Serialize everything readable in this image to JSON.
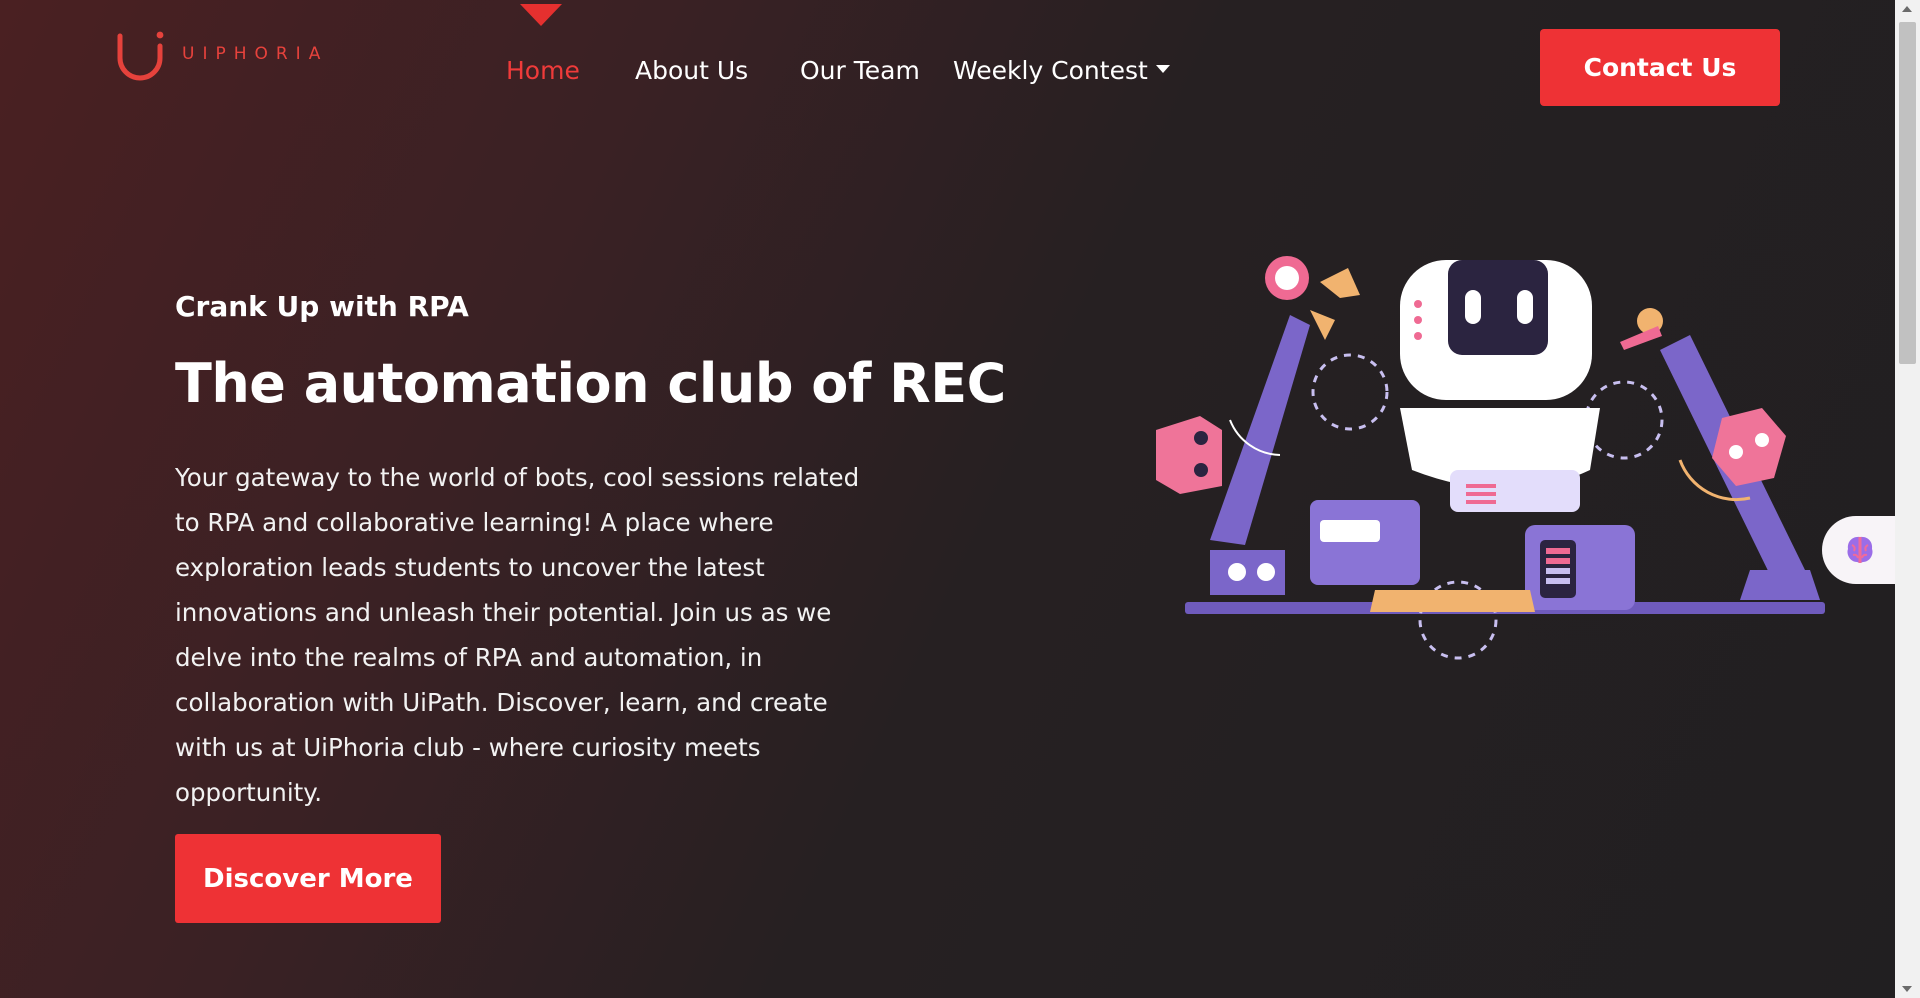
{
  "brand": {
    "name": "UIPHORIA",
    "accent": "#e6423c"
  },
  "nav": {
    "items": [
      {
        "label": "Home",
        "active": true
      },
      {
        "label": "About Us",
        "active": false
      },
      {
        "label": "Our Team",
        "active": false
      },
      {
        "label": "Weekly Contest",
        "active": false,
        "dropdown": true
      }
    ]
  },
  "header": {
    "contact_label": "Contact Us"
  },
  "hero": {
    "eyebrow": "Crank Up with RPA",
    "headline": "The automation club of REC",
    "description": "Your gateway to the world of bots, cool sessions related to RPA and collaborative learning! A place where exploration leads students to uncover the latest innovations and unleash their potential. Join us as we delve into the realms of RPA and automation, in collaboration with UiPath. Discover, learn, and create with us at UiPhoria club - where curiosity meets opportunity.",
    "cta_label": "Discover More",
    "illustration": "robot-arms-illustration"
  },
  "widget": {
    "icon": "brain-icon"
  },
  "colors": {
    "primary_button": "#ee3235",
    "background_dark": "#211f21",
    "background_warm": "#4a2022"
  }
}
